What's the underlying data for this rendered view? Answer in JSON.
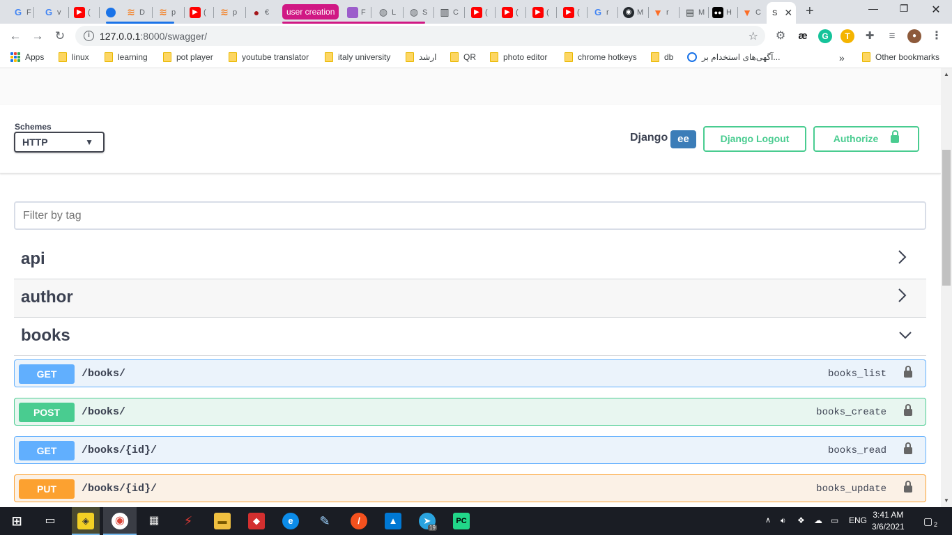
{
  "browser": {
    "tabs": [
      {
        "icon": "google-icon",
        "letter": "F"
      },
      {
        "icon": "google-icon",
        "letter": "v"
      },
      {
        "icon": "youtube-icon",
        "letter": "("
      },
      {
        "icon": "blue-dot-icon",
        "letter": ""
      },
      {
        "icon": "stackoverflow-icon",
        "letter": "D"
      },
      {
        "icon": "stackoverflow-icon",
        "letter": "p"
      },
      {
        "icon": "youtube-icon",
        "letter": "("
      },
      {
        "icon": "stackoverflow-icon",
        "letter": "p"
      },
      {
        "icon": "red-figure-icon",
        "letter": "€"
      }
    ],
    "tab_group_label": "user creation",
    "tabs2": [
      {
        "icon": "purple-square-icon",
        "letter": "F"
      },
      {
        "icon": "globe-icon",
        "letter": "L"
      },
      {
        "icon": "globe-icon",
        "letter": "S"
      },
      {
        "icon": "book-icon",
        "letter": "C"
      },
      {
        "icon": "youtube-icon",
        "letter": "("
      },
      {
        "icon": "youtube-icon",
        "letter": "("
      },
      {
        "icon": "youtube-icon",
        "letter": "("
      },
      {
        "icon": "youtube-icon",
        "letter": "("
      },
      {
        "icon": "google-icon",
        "letter": "r"
      },
      {
        "icon": "github-icon",
        "letter": "M"
      },
      {
        "icon": "gitlab-icon",
        "letter": "r"
      },
      {
        "icon": "document-icon",
        "letter": "M"
      },
      {
        "icon": "medium-icon",
        "letter": "H"
      },
      {
        "icon": "gitlab-icon",
        "letter": "C"
      }
    ],
    "active_tab": {
      "icon": "swagger-icon",
      "letter": "S"
    },
    "url_host": "127.0.0.1",
    "url_path": ":8000/swagger/"
  },
  "bookmarks": {
    "apps": "Apps",
    "items": [
      "linux",
      "learning",
      "pot player",
      "youtube translator",
      "italy university",
      "ارشد",
      "QR",
      "photo editor",
      "chrome hotkeys",
      "db"
    ],
    "persian_site": "آگهی‌های استخدام بر...",
    "more": "»",
    "other": "Other bookmarks"
  },
  "swagger": {
    "schemes_label": "Schemes",
    "scheme_selected": "HTTP",
    "django_label": "Django",
    "django_badge": "ee",
    "logout_label": "Django Logout",
    "authorize_label": "Authorize",
    "filter_placeholder": "Filter by tag",
    "tags": [
      {
        "name": "api",
        "expanded": false
      },
      {
        "name": "author",
        "expanded": false
      },
      {
        "name": "books",
        "expanded": true
      }
    ],
    "operations": [
      {
        "method": "GET",
        "path": "/books/",
        "operation_id": "books_list"
      },
      {
        "method": "POST",
        "path": "/books/",
        "operation_id": "books_create"
      },
      {
        "method": "GET",
        "path": "/books/{id}/",
        "operation_id": "books_read"
      },
      {
        "method": "PUT",
        "path": "/books/{id}/",
        "operation_id": "books_update"
      }
    ]
  },
  "taskbar": {
    "language": "ENG",
    "time": "3:41 AM",
    "date": "3/6/2021",
    "notifications": "2",
    "telegram_badge": "19"
  },
  "colors": {
    "get": "#61affe",
    "post": "#49cc90",
    "put": "#fca130",
    "tab_group": "#d01884"
  }
}
